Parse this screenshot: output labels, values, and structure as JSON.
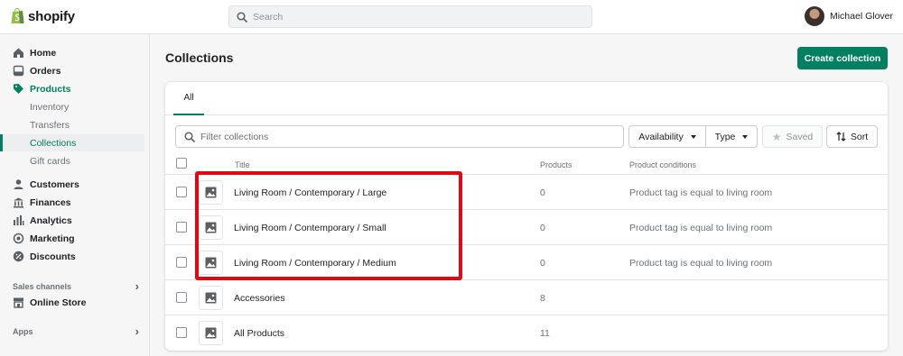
{
  "topbar": {
    "logo_text": "shopify",
    "search_placeholder": "Search",
    "user_name": "Michael Glover"
  },
  "sidebar": {
    "items": [
      {
        "label": "Home",
        "icon": "home-icon"
      },
      {
        "label": "Orders",
        "icon": "orders-icon"
      },
      {
        "label": "Products",
        "icon": "tag-icon"
      },
      {
        "label": "Inventory"
      },
      {
        "label": "Transfers"
      },
      {
        "label": "Collections"
      },
      {
        "label": "Gift cards"
      },
      {
        "label": "Customers",
        "icon": "person-icon"
      },
      {
        "label": "Finances",
        "icon": "bank-icon"
      },
      {
        "label": "Analytics",
        "icon": "bar-chart-icon"
      },
      {
        "label": "Marketing",
        "icon": "target-icon"
      },
      {
        "label": "Discounts",
        "icon": "discount-icon"
      },
      {
        "label": "Online Store",
        "icon": "store-icon"
      }
    ],
    "sales_channels_heading": "Sales channels",
    "apps_heading": "Apps"
  },
  "page": {
    "title": "Collections",
    "create_button": "Create collection"
  },
  "tabs": [
    {
      "label": "All"
    }
  ],
  "filters": {
    "placeholder": "Filter collections",
    "availability": "Availability",
    "type": "Type",
    "saved": "Saved",
    "sort": "Sort"
  },
  "table": {
    "headers": {
      "title": "Title",
      "products": "Products",
      "conditions": "Product conditions"
    },
    "rows": [
      {
        "title": "Living Room / Contemporary / Large",
        "products": "0",
        "conditions": "Product tag is equal to living room"
      },
      {
        "title": "Living Room / Contemporary / Small",
        "products": "0",
        "conditions": "Product tag is equal to living room"
      },
      {
        "title": "Living Room / Contemporary / Medium",
        "products": "0",
        "conditions": "Product tag is equal to living room"
      },
      {
        "title": "Accessories",
        "products": "8",
        "conditions": ""
      },
      {
        "title": "All Products",
        "products": "11",
        "conditions": ""
      }
    ]
  },
  "colors": {
    "accent": "#008060",
    "highlight": "#e30613"
  }
}
